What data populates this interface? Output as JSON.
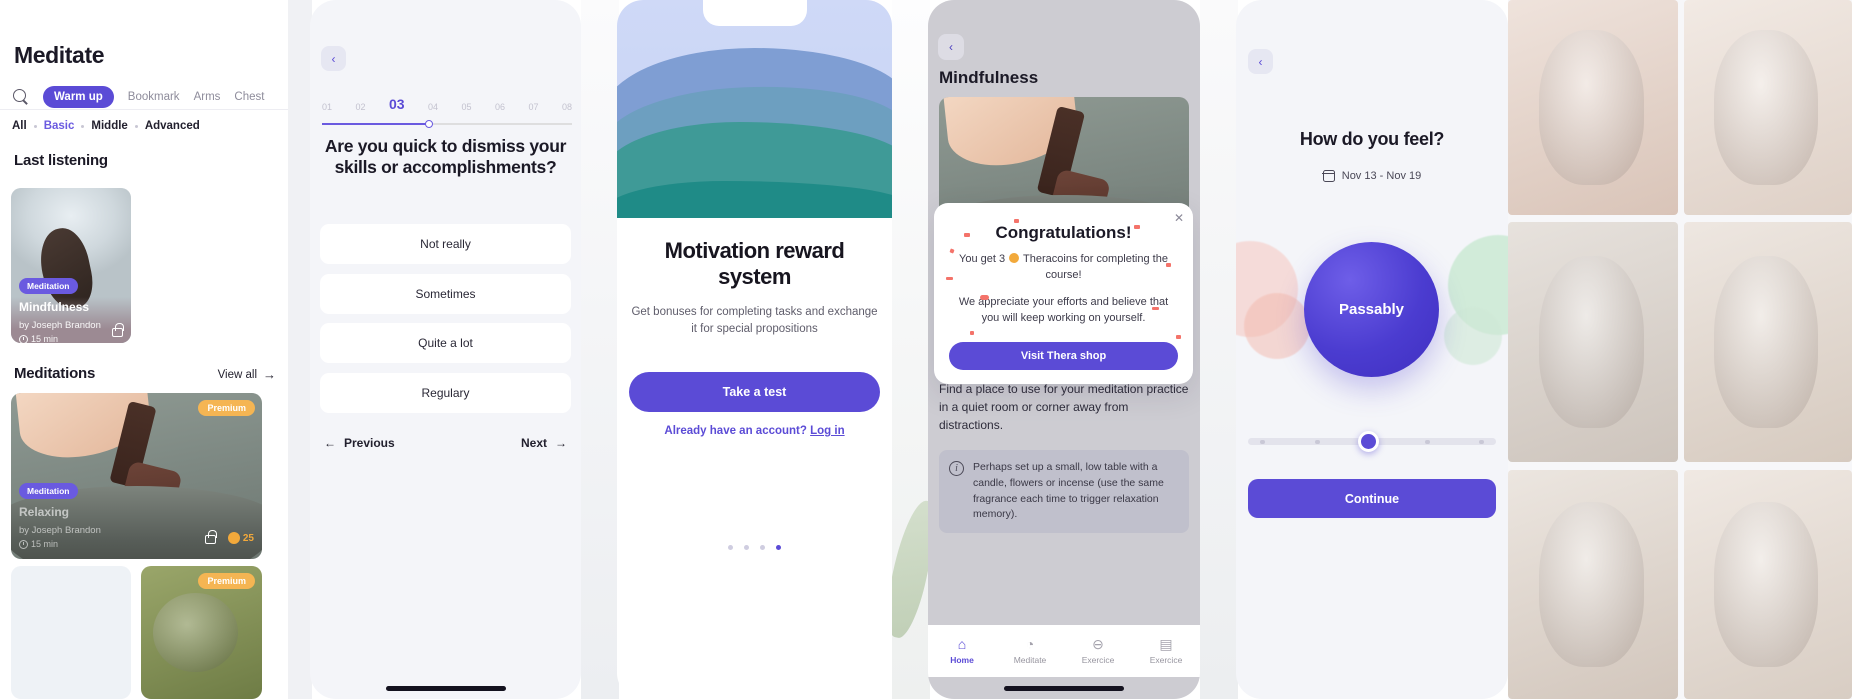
{
  "panel1": {
    "title": "Meditate",
    "search_icon": "search-icon",
    "tabs": [
      {
        "label": "Warm up",
        "active": true
      },
      {
        "label": "Bookmark",
        "active": false
      },
      {
        "label": "Arms",
        "active": false
      },
      {
        "label": "Chest",
        "active": false
      }
    ],
    "levels": [
      {
        "label": "All",
        "active": false
      },
      {
        "label": "Basic",
        "active": true
      },
      {
        "label": "Middle",
        "active": false
      },
      {
        "label": "Advanced",
        "active": false
      }
    ],
    "section_last": "Last listening",
    "section_meditations": "Meditations",
    "view_all": "View all",
    "view_all_arrow": "→",
    "card_last": {
      "category": "Meditation",
      "title": "Mindfulness",
      "author": "by Joseph Brandon",
      "duration": "15 min",
      "lock_icon": "unlock-icon"
    },
    "card_meditation": {
      "badge": "Premium",
      "category": "Meditation",
      "title": "Relaxing",
      "author": "by Joseph Brandon",
      "duration": "15 min",
      "lock_icon": "lock-icon",
      "coins": "25"
    },
    "card_bottom": {
      "badge": "Premium"
    }
  },
  "panel2": {
    "back_icon": "chevron-left-icon",
    "steps": [
      "01",
      "02",
      "03",
      "04",
      "05",
      "06",
      "07",
      "08"
    ],
    "current_step": "03",
    "question": "Are you quick to dismiss your skills or accomplishments?",
    "options": [
      "Not really",
      "Sometimes",
      "Quite a lot",
      "Regulary"
    ],
    "previous": "Previous",
    "next": "Next",
    "prev_arrow": "←",
    "next_arrow": "→"
  },
  "panel3": {
    "title": "Motivation reward system",
    "subtitle": "Get bonuses for completing tasks and exchange it for special propositions",
    "cta": "Take a test",
    "login_prefix": "Already have an account? ",
    "login_link": "Log in",
    "dots": 4,
    "active_dot": 3
  },
  "panel4": {
    "back_icon": "chevron-left-icon",
    "title": "Mindfulness",
    "modal": {
      "close_icon": "close-icon",
      "heading": "Congratulations!",
      "line1_a": "You get 3",
      "line1_b": "Theracoins for completing the course!",
      "line2": "We appreciate your efforts and believe that you will keep working on yourself.",
      "button": "Visit Thera shop"
    },
    "body": "Find a place to use for your meditation practice in a quiet room or corner away from distractions.",
    "tip_icon": "info-icon",
    "tip": "Perhaps set up a small, low table with a candle, flowers or incense (use the same fragrance each time to trigger relaxation memory).",
    "nav": [
      {
        "label": "Home",
        "icon": "home-icon",
        "glyph": "⌂",
        "active": true
      },
      {
        "label": "Meditate",
        "icon": "meditate-icon",
        "glyph": "◔",
        "active": false
      },
      {
        "label": "Exercice",
        "icon": "exercise-icon",
        "glyph": "⊖",
        "active": false
      },
      {
        "label": "Exercice",
        "icon": "book-icon",
        "glyph": "▤",
        "active": false
      }
    ]
  },
  "panel5": {
    "back_icon": "chevron-left-icon",
    "title": "How do you feel?",
    "calendar_icon": "calendar-icon",
    "date_range": "Nov 13 - Nov 19",
    "mood": "Passably",
    "continue": "Continue",
    "slider_ticks": 5,
    "slider_value": 3
  },
  "colors": {
    "accent": "#5b4bd6",
    "accent_light": "#6a5ae0",
    "premium": "#f5b553",
    "coin": "#f2a93b",
    "text_dark": "#1b1926",
    "text_muted": "#8e8c9b"
  }
}
